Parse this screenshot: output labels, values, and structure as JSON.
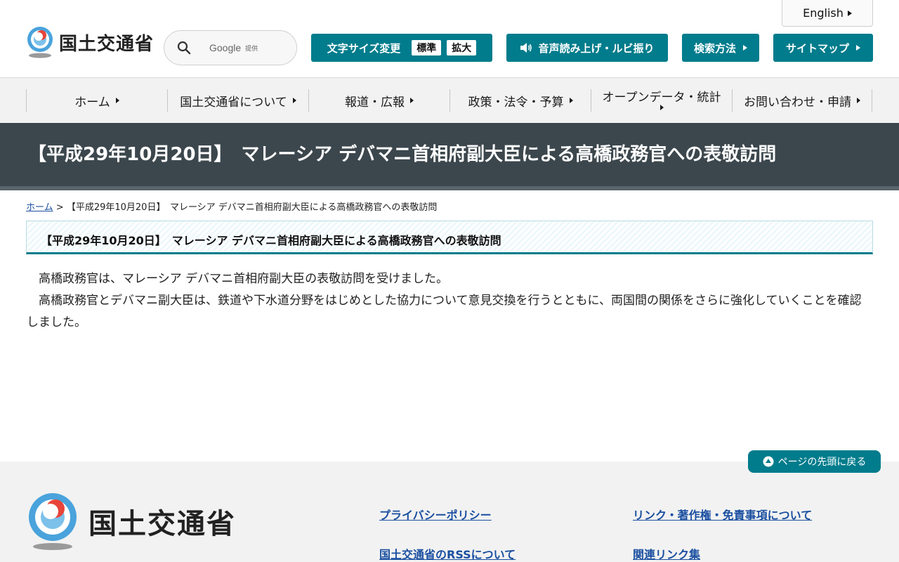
{
  "header": {
    "logo_text": "国土交通省",
    "search_provider": "Google",
    "search_provider_suffix": "提供",
    "english_label": "English",
    "font_size_label": "文字サイズ変更",
    "font_standard": "標準",
    "font_large": "拡大",
    "speech_label": "音声読み上げ・ルビ振り",
    "search_method_label": "検索方法",
    "sitemap_label": "サイトマップ"
  },
  "nav": {
    "items": [
      {
        "label": "ホーム"
      },
      {
        "label": "国土交通省について"
      },
      {
        "label": "報道・広報"
      },
      {
        "label": "政策・法令・予算"
      },
      {
        "label": "オープンデータ・統計"
      },
      {
        "label": "お問い合わせ・申請"
      }
    ]
  },
  "page": {
    "title": "【平成29年10月20日】　マレーシア デバマニ首相府副大臣による高橋政務官への表敬訪問",
    "breadcrumb_home": "ホーム",
    "breadcrumb_sep": ">",
    "breadcrumb_current": "【平成29年10月20日】　マレーシア デバマニ首相府副大臣による高橋政務官への表敬訪問",
    "heading": "【平成29年10月20日】　マレーシア デバマニ首相府副大臣による高橋政務官への表敬訪問",
    "paragraph1": "高橋政務官は、マレーシア デバマニ首相府副大臣の表敬訪問を受けました。",
    "paragraph2": "高橋政務官とデバマニ副大臣は、鉄道や下水道分野をはじめとした協力について意見交換を行うとともに、両国間の関係をさらに強化していくことを確認しました。"
  },
  "back_to_top": "ページの先頭に戻る",
  "footer": {
    "logo_text": "国土交通省",
    "links": [
      {
        "label": "プライバシーポリシー"
      },
      {
        "label": "リンク・著作権・免責事項について"
      },
      {
        "label": "国土交通省のRSSについて"
      },
      {
        "label": "関連リンク集"
      }
    ]
  },
  "colors": {
    "accent": "#007c8c",
    "title_band": "#3c474d",
    "link": "#1a4fa0"
  }
}
